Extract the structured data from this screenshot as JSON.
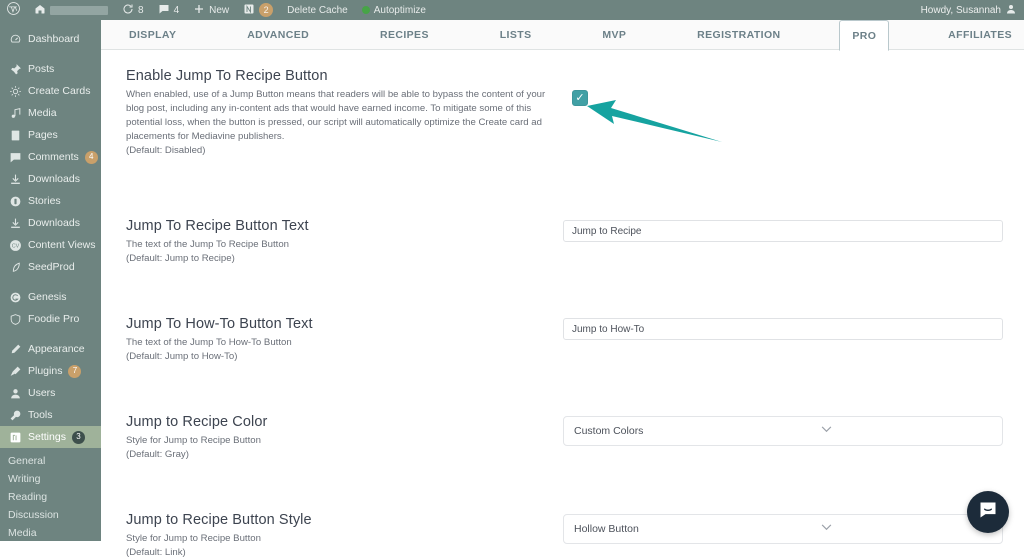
{
  "adminbar": {
    "wp_logo_icon": "wordpress-logo-icon",
    "site_home_icon": "home-icon",
    "site_name_redacted": "",
    "updates_icon": "updates-icon",
    "updates_count": "8",
    "comments_icon": "comments-icon",
    "comments_count": "4",
    "new_icon": "plus-icon",
    "new_label": "New",
    "plugin_icon": "yoast-icon",
    "plugin_count": "2",
    "delete_cache_label": "Delete Cache",
    "autoptimize_status_icon": "green-dot-icon",
    "autoptimize_label": "Autoptimize",
    "howdy_label": "Howdy, Susannah",
    "avatar_icon": "user-avatar-icon"
  },
  "sidebar": {
    "items": [
      {
        "label": "Dashboard",
        "icon": "dashboard-icon",
        "badge": ""
      },
      {
        "label": "Posts",
        "icon": "pin-icon",
        "badge": ""
      },
      {
        "label": "Create Cards",
        "icon": "create-cards-icon",
        "badge": ""
      },
      {
        "label": "Media",
        "icon": "media-icon",
        "badge": ""
      },
      {
        "label": "Pages",
        "icon": "pages-icon",
        "badge": ""
      },
      {
        "label": "Comments",
        "icon": "comments-icon",
        "badge": "4"
      },
      {
        "label": "Downloads",
        "icon": "download-icon",
        "badge": ""
      },
      {
        "label": "Stories",
        "icon": "stories-icon",
        "badge": ""
      },
      {
        "label": "Downloads",
        "icon": "download-icon",
        "badge": ""
      },
      {
        "label": "Content Views",
        "icon": "content-views-icon",
        "badge": ""
      },
      {
        "label": "SeedProd",
        "icon": "seedprod-icon",
        "badge": ""
      },
      {
        "label": "Genesis",
        "icon": "genesis-icon",
        "badge": ""
      },
      {
        "label": "Foodie Pro",
        "icon": "foodie-pro-icon",
        "badge": ""
      },
      {
        "label": "Appearance",
        "icon": "appearance-icon",
        "badge": ""
      },
      {
        "label": "Plugins",
        "icon": "plugins-icon",
        "badge": "7"
      },
      {
        "label": "Users",
        "icon": "users-icon",
        "badge": ""
      },
      {
        "label": "Tools",
        "icon": "tools-icon",
        "badge": ""
      },
      {
        "label": "Settings",
        "icon": "settings-icon",
        "badge": "3"
      }
    ],
    "submenu": [
      {
        "label": "General"
      },
      {
        "label": "Writing"
      },
      {
        "label": "Reading"
      },
      {
        "label": "Discussion"
      },
      {
        "label": "Media"
      }
    ]
  },
  "tabs": [
    {
      "label": "DISPLAY",
      "active": false
    },
    {
      "label": "ADVANCED",
      "active": false
    },
    {
      "label": "RECIPES",
      "active": false
    },
    {
      "label": "LISTS",
      "active": false
    },
    {
      "label": "MVP",
      "active": false
    },
    {
      "label": "REGISTRATION",
      "active": false
    },
    {
      "label": "PRO",
      "active": true
    },
    {
      "label": "AFFILIATES",
      "active": false
    }
  ],
  "settings": {
    "enable_jump": {
      "title": "Enable Jump To Recipe Button",
      "description": "When enabled, use of a Jump Button means that readers will be able to bypass the content of your blog post, including any in-content ads that would have earned income. To mitigate some of this potential loss, when the button is pressed, our script will automatically optimize the Create card ad placements for Mediavine publishers.",
      "default": "(Default: Disabled)",
      "checked_glyph": "✓"
    },
    "recipe_button_text": {
      "title": "Jump To Recipe Button Text",
      "description": "The text of the Jump To Recipe Button",
      "default": "(Default: Jump to Recipe)",
      "value": "Jump to Recipe"
    },
    "howto_button_text": {
      "title": "Jump To How-To Button Text",
      "description": "The text of the Jump To How-To Button",
      "default": "(Default: Jump to How-To)",
      "value": "Jump to How-To"
    },
    "recipe_color": {
      "title": "Jump to Recipe Color",
      "description": "Style for Jump to Recipe Button",
      "default": "(Default: Gray)",
      "value": "Custom Colors"
    },
    "recipe_button_style": {
      "title": "Jump to Recipe Button Style",
      "description": "Style for Jump to Recipe Button",
      "default": "(Default: Link)",
      "value": "Hollow Button"
    }
  },
  "annotation": {
    "arrow_icon": "arrow-pointing-left-icon",
    "arrow_color": "#16a3a0"
  },
  "chat_widget": {
    "icon": "intercom-chat-icon"
  },
  "colors": {
    "sidebar_bg": "#6e8480",
    "accent_teal": "#41a0a5",
    "annotation_teal": "#16a3a0",
    "tab_text": "#6c8088",
    "title_text": "#3d4450"
  }
}
